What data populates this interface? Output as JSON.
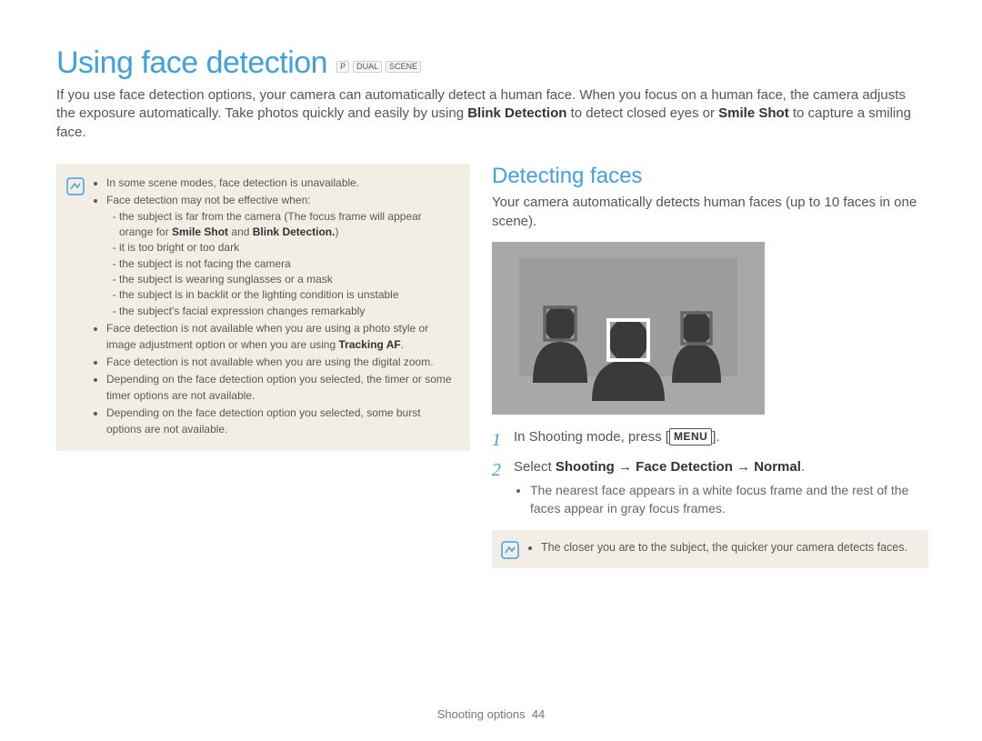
{
  "title": "Using face detection",
  "mode_icons": [
    "P",
    "DUAL",
    "SCENE"
  ],
  "intro": {
    "pre": "If you use face detection options, your camera can automatically detect a human face. When you focus on a human face, the camera adjusts the exposure automatically. Take photos quickly and easily by using ",
    "b1": "Blink Detection",
    "mid": " to detect closed eyes or ",
    "b2": "Smile Shot",
    "post": " to capture a smiling face."
  },
  "left_note": {
    "items": [
      {
        "text": "In some scene modes, face detection is unavailable."
      },
      {
        "text": "Face detection may not be effective when:",
        "sub": [
          {
            "pre": "the subject is far from the camera (The focus frame will appear orange for ",
            "b": "Smile Shot",
            "mid": " and ",
            "b2": "Blink Detection.",
            "post": ")"
          },
          {
            "text": "it is too bright or too dark"
          },
          {
            "text": "the subject is not facing the camera"
          },
          {
            "text": "the subject is wearing sunglasses or a mask"
          },
          {
            "text": "the subject is in backlit or the lighting condition is unstable"
          },
          {
            "text": "the subject's facial expression changes remarkably"
          }
        ]
      },
      {
        "pre": "Face detection is not available when you are using a photo style or image adjustment option or when you are using ",
        "b": "Tracking AF",
        "post": "."
      },
      {
        "text": "Face detection is not available when you are using the digital zoom."
      },
      {
        "text": "Depending on the face detection option you selected, the timer or some timer options are not available."
      },
      {
        "text": "Depending on the face detection option you selected, some burst options are not available."
      }
    ]
  },
  "right": {
    "heading": "Detecting faces",
    "para": "Your camera automatically detects human faces (up to 10 faces in one scene).",
    "steps": [
      {
        "n": "1",
        "pre": "In Shooting mode, press [",
        "btn": "MENU",
        "post": "]."
      },
      {
        "n": "2",
        "pre": "Select ",
        "b": "Shooting → Face Detection → Normal",
        "post": ".",
        "sub": "The nearest face appears in a white focus frame and the rest of the faces appear in gray focus frames."
      }
    ],
    "note": "The closer you are to the subject, the quicker your camera detects faces."
  },
  "footer": {
    "section": "Shooting options",
    "page": "44"
  }
}
